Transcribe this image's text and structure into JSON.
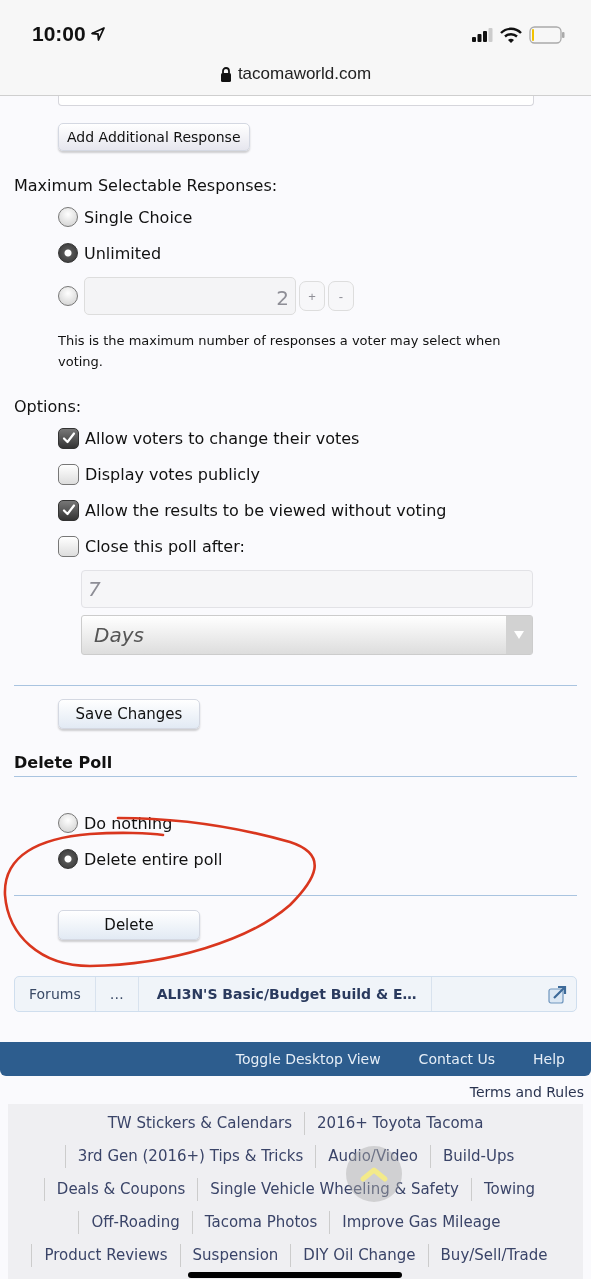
{
  "status_bar": {
    "time": "10:00",
    "url": "tacomaworld.com"
  },
  "add_response_button": "Add Additional Response",
  "max_responses": {
    "label": "Maximum Selectable Responses:",
    "options": [
      {
        "kind": "text",
        "label": "Single Choice",
        "selected": false
      },
      {
        "kind": "text",
        "label": "Unlimited",
        "selected": true
      },
      {
        "kind": "number",
        "value": "2",
        "selected": false,
        "disabled": true,
        "buttons": [
          "+",
          "-"
        ]
      }
    ],
    "hint": "This is the maximum number of responses a voter may select when voting."
  },
  "options": {
    "label": "Options:",
    "items": [
      {
        "label": "Allow voters to change their votes",
        "checked": true
      },
      {
        "label": "Display votes publicly",
        "checked": false
      },
      {
        "label": "Allow the results to be viewed without voting",
        "checked": true
      },
      {
        "label": "Close this poll after:",
        "checked": false
      }
    ],
    "close_after": {
      "value": "7",
      "unit": "Days",
      "disabled": true
    }
  },
  "save_button": "Save Changes",
  "delete_poll": {
    "title": "Delete Poll",
    "options": [
      {
        "label": "Do nothing",
        "selected": false
      },
      {
        "label": "Delete entire poll",
        "selected": true
      }
    ],
    "button": "Delete"
  },
  "breadcrumb": [
    "Forums",
    "…",
    "ALI3N'S Basic/Budget Build & E…"
  ],
  "footer": {
    "links": [
      "Toggle Desktop View",
      "Contact Us",
      "Help"
    ],
    "terms": "Terms and Rules",
    "site_links": [
      [
        "TW Stickers & Calendars",
        "2016+ Toyota Tacoma"
      ],
      [
        "3rd Gen (2016+) Tips & Tricks",
        "Audio/Video",
        "Build-Ups"
      ],
      [
        "Deals & Coupons",
        "Single Vehicle Wheeling & Safety",
        "Towing"
      ],
      [
        "Off-Roading",
        "Tacoma Photos",
        "Improve Gas Mileage"
      ],
      [
        "Product Reviews",
        "Suspension",
        "DIY Oil Change",
        "Buy/Sell/Trade"
      ]
    ]
  }
}
